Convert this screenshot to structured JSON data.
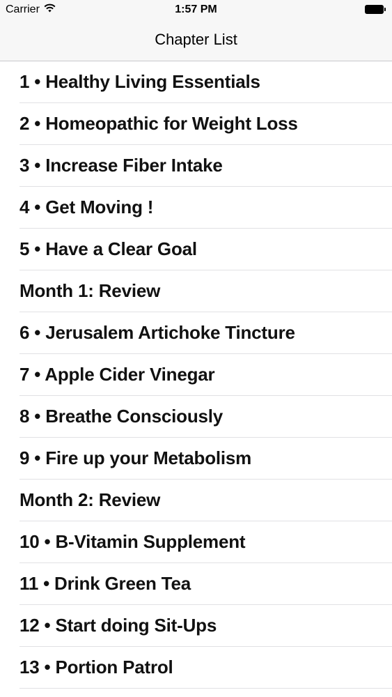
{
  "status_bar": {
    "carrier": "Carrier",
    "time": "1:57 PM"
  },
  "nav": {
    "title": "Chapter List"
  },
  "chapters": [
    {
      "label": "1 • Healthy Living Essentials"
    },
    {
      "label": "2 • Homeopathic for Weight Loss"
    },
    {
      "label": "3 • Increase Fiber Intake"
    },
    {
      "label": "4 • Get Moving !"
    },
    {
      "label": "5 • Have a Clear Goal"
    },
    {
      "label": "Month 1: Review"
    },
    {
      "label": "6 • Jerusalem Artichoke Tincture"
    },
    {
      "label": "7 • Apple Cider Vinegar"
    },
    {
      "label": "8 • Breathe Consciously"
    },
    {
      "label": "9 • Fire up your Metabolism"
    },
    {
      "label": "Month 2: Review"
    },
    {
      "label": "10 • B-Vitamin Supplement"
    },
    {
      "label": "11 • Drink Green Tea"
    },
    {
      "label": "12 • Start doing Sit-Ups"
    },
    {
      "label": "13 • Portion Patrol"
    }
  ]
}
